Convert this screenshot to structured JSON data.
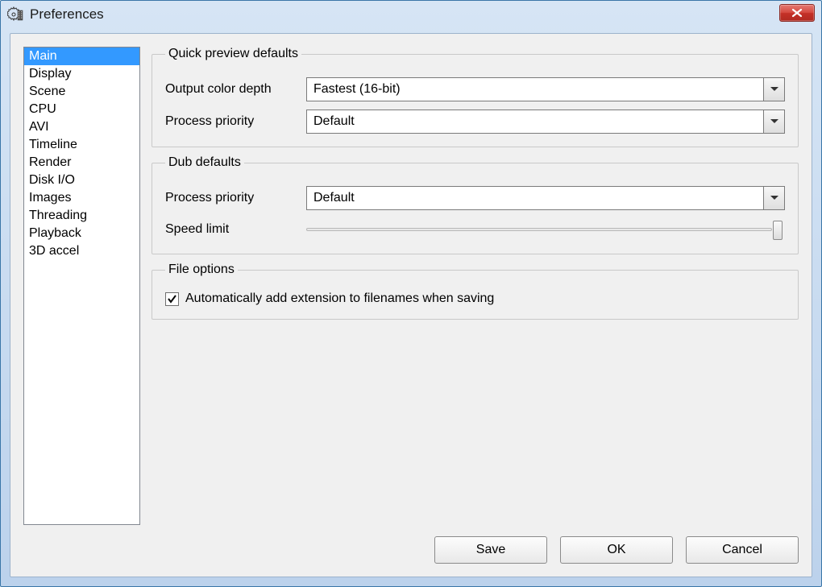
{
  "window": {
    "title": "Preferences"
  },
  "sidebar": {
    "items": [
      "Main",
      "Display",
      "Scene",
      "CPU",
      "AVI",
      "Timeline",
      "Render",
      "Disk I/O",
      "Images",
      "Threading",
      "Playback",
      "3D accel"
    ],
    "selected_index": 0
  },
  "groups": {
    "quick_preview": {
      "legend": "Quick preview defaults",
      "output_color_depth": {
        "label": "Output color depth",
        "value": "Fastest (16-bit)"
      },
      "process_priority": {
        "label": "Process priority",
        "value": "Default"
      }
    },
    "dub": {
      "legend": "Dub defaults",
      "process_priority": {
        "label": "Process priority",
        "value": "Default"
      },
      "speed_limit": {
        "label": "Speed limit",
        "position_pct": 100
      }
    },
    "file_options": {
      "legend": "File options",
      "auto_ext": {
        "label": "Automatically add extension to filenames when saving",
        "checked": true
      }
    }
  },
  "buttons": {
    "save": "Save",
    "ok": "OK",
    "cancel": "Cancel"
  }
}
